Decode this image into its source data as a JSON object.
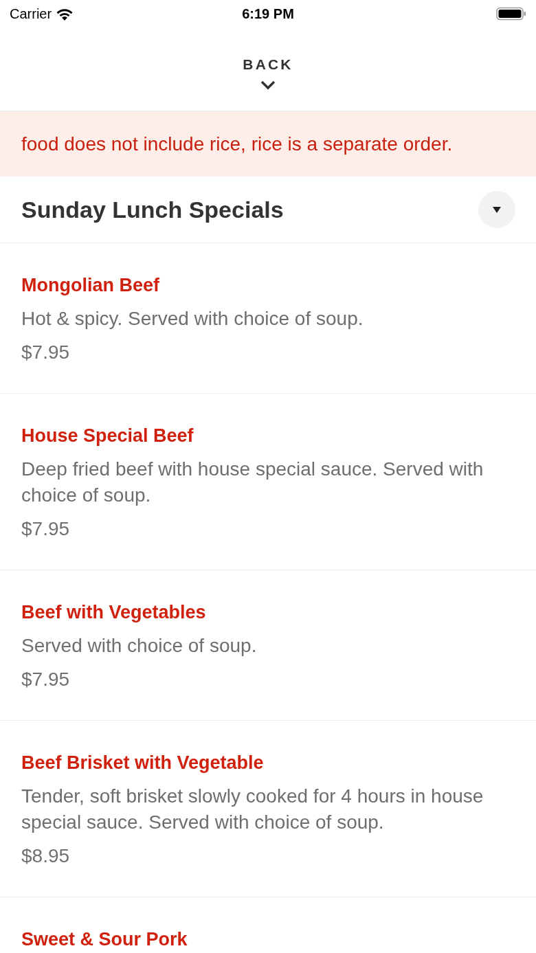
{
  "status_bar": {
    "carrier": "Carrier",
    "time": "6:19 PM"
  },
  "header": {
    "back_label": "BACK"
  },
  "notice": {
    "text": "food does not include rice, rice is a separate order."
  },
  "section": {
    "title": "Sunday Lunch Specials"
  },
  "items": [
    {
      "name": "Mongolian Beef",
      "description": "Hot & spicy. Served with choice of soup.",
      "price": "$7.95"
    },
    {
      "name": "House Special Beef",
      "description": "Deep fried beef with house special sauce. Served with choice of soup.",
      "price": "$7.95"
    },
    {
      "name": "Beef with Vegetables",
      "description": "Served with choice of soup.",
      "price": "$7.95"
    },
    {
      "name": "Beef Brisket with Vegetable",
      "description": "Tender, soft brisket slowly cooked for 4 hours in house special sauce. Served with choice of soup.",
      "price": "$8.95"
    },
    {
      "name": "Sweet & Sour Pork"
    }
  ]
}
